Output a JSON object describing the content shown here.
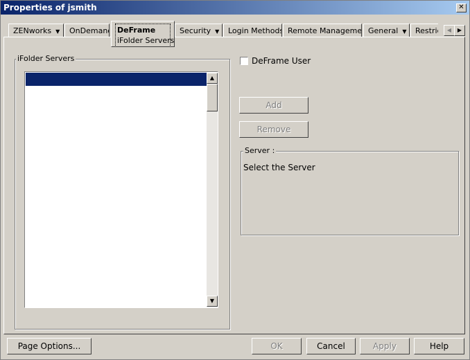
{
  "window": {
    "title": "Properties of jsmith",
    "close_label": "✕"
  },
  "tabs": [
    {
      "label": "ZENworks",
      "dropdown": true
    },
    {
      "label": "OnDemand"
    },
    {
      "label": "DeFrame",
      "sublabel": "iFolder Servers",
      "active": true
    },
    {
      "label": "Security",
      "dropdown": true
    },
    {
      "label": "Login Methods"
    },
    {
      "label": "Remote Management"
    },
    {
      "label": "General",
      "dropdown": true
    },
    {
      "label": "Restric"
    }
  ],
  "tab_scroll": {
    "left": "◀",
    "right": "▶"
  },
  "ifolder": {
    "group_label": "iFolder Servers",
    "items": [
      ""
    ]
  },
  "deframe_user": {
    "label": "DeFrame User",
    "checked": false
  },
  "buttons": {
    "add": "Add",
    "remove": "Remove"
  },
  "server": {
    "group_label": "Server :",
    "text": "Select the Server"
  },
  "footer": {
    "page_options": "Page Options...",
    "ok": "OK",
    "cancel": "Cancel",
    "apply": "Apply",
    "help": "Help"
  },
  "icons": {
    "dropdown": "▼",
    "up": "▲",
    "down": "▼"
  }
}
